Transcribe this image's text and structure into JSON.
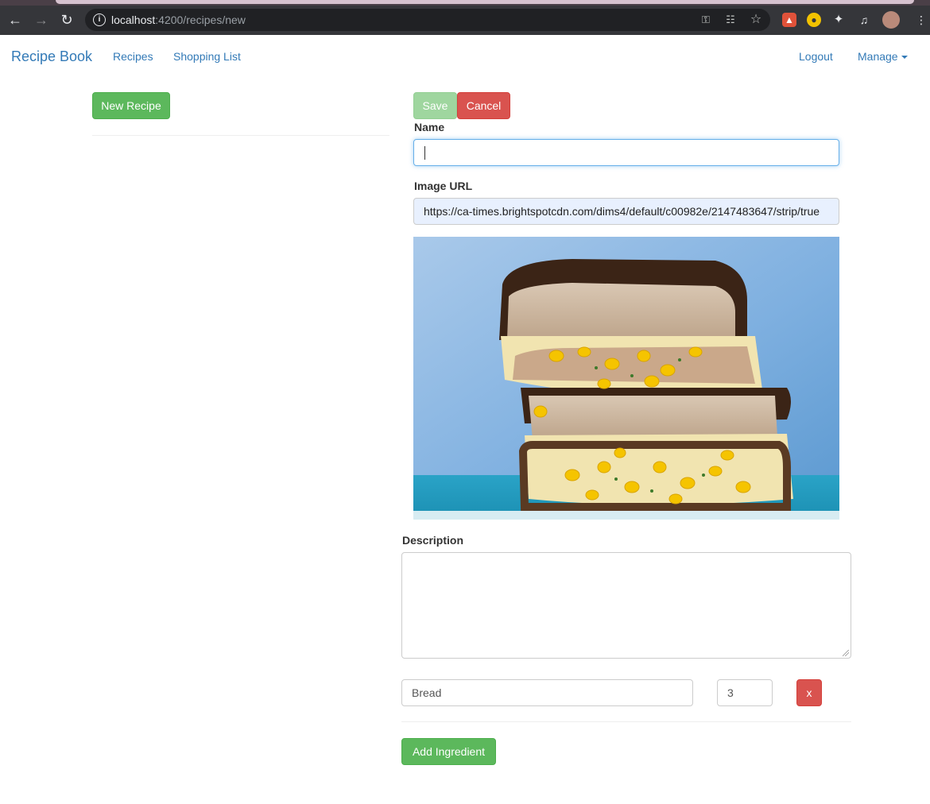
{
  "browser": {
    "url_host": "localhost",
    "url_path": ":4200/recipes/new"
  },
  "navbar": {
    "brand": "Recipe Book",
    "links": [
      "Recipes",
      "Shopping List"
    ],
    "logout": "Logout",
    "manage": "Manage"
  },
  "list": {
    "new_recipe_button": "New Recipe"
  },
  "form": {
    "save_label": "Save",
    "cancel_label": "Cancel",
    "name_label": "Name",
    "name_value": "",
    "image_url_label": "Image URL",
    "image_url_value": "https://ca-times.brightspotcdn.com/dims4/default/c00982e/2147483647/strip/true",
    "description_label": "Description",
    "description_value": "",
    "ingredients": [
      {
        "name": "Bread",
        "amount": "3",
        "delete_label": "x"
      }
    ],
    "add_ingredient_label": "Add Ingredient"
  },
  "colors": {
    "link": "#337ab7",
    "success": "#5cb85c",
    "danger": "#d9534f"
  }
}
